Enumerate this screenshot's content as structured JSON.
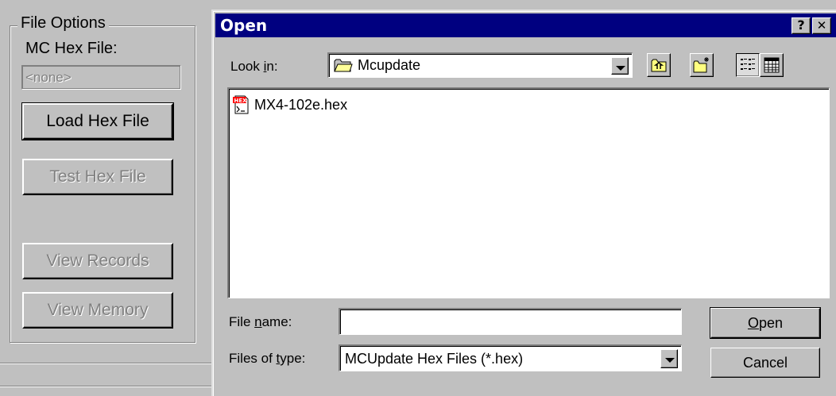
{
  "left_panel": {
    "group_title": "File Options",
    "hex_file_label": "MC Hex File:",
    "hex_file_value": "<none>",
    "load_button": "Load Hex File",
    "test_button": "Test Hex File",
    "view_records_button": "View Records",
    "view_memory_button": "View Memory"
  },
  "dialog": {
    "title": "Open",
    "help_button": "?",
    "close_button": "✕",
    "look_in_label_prefix": "Look ",
    "look_in_label_accel": "i",
    "look_in_label_suffix": "n:",
    "look_in_value": "Mcupdate",
    "toolbar": {
      "up_folder": "up-one-level-icon",
      "new_folder": "create-new-folder-icon",
      "list_view": "list-view-icon",
      "details_view": "details-view-icon"
    },
    "files": [
      {
        "name": "MX4-102e.hex",
        "icon": "hex-file-icon"
      }
    ],
    "file_name_label_prefix": "File ",
    "file_name_label_accel": "n",
    "file_name_label_suffix": "ame:",
    "file_name_value": "",
    "files_of_type_label_prefix": "Files of ",
    "files_of_type_label_accel": "t",
    "files_of_type_label_suffix": "ype:",
    "files_of_type_value": "MCUpdate Hex Files (*.hex)",
    "open_button_accel": "O",
    "open_button_rest": "pen",
    "cancel_button": "Cancel"
  },
  "colors": {
    "face": "#c0c0c0",
    "titlebar": "#000080",
    "disabled_text": "#808080"
  }
}
